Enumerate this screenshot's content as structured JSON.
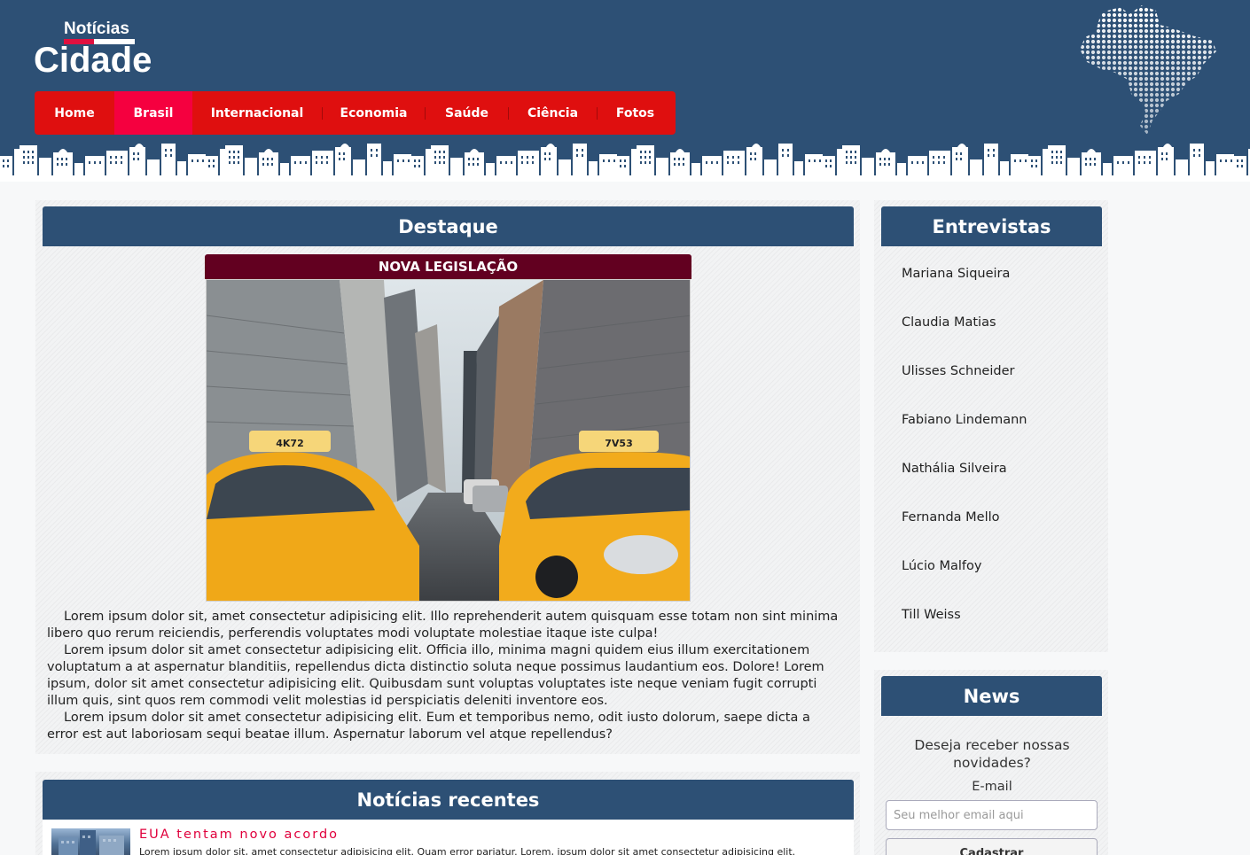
{
  "site": {
    "logo_top": "Notícias",
    "logo_main": "Cidade"
  },
  "nav": {
    "items": [
      {
        "label": "Home"
      },
      {
        "label": "Brasil"
      },
      {
        "label": "Internacional"
      },
      {
        "label": "Economia"
      },
      {
        "label": "Saúde"
      },
      {
        "label": "Ciência"
      },
      {
        "label": "Fotos"
      }
    ],
    "active": "Brasil"
  },
  "destaque": {
    "heading": "Destaque",
    "feature_title": "NOVA LEGISLAÇÃO",
    "image_alt": "táxis amarelos em rua entre prédios",
    "taxi_left": "4K72",
    "taxi_right": "7V53",
    "paragraphs": [
      "Lorem ipsum dolor sit, amet consectetur adipisicing elit. Illo reprehenderit autem quisquam esse totam non sint minima libero quo rerum reiciendis, perferendis voluptates modi voluptate molestiae itaque iste culpa!",
      "Lorem ipsum dolor sit amet consectetur adipisicing elit. Officia illo, minima magni quidem eius illum exercitationem voluptatum a at aspernatur blanditiis, repellendus dicta distinctio soluta neque possimus laudantium eos. Dolore! Lorem ipsum, dolor sit amet consectetur adipisicing elit. Quibusdam sunt voluptas voluptates iste neque veniam fugit corrupti illum quis, sint quos rem commodi velit molestias id perspiciatis deleniti inventore eos.",
      "Lorem ipsum dolor sit amet consectetur adipisicing elit. Eum et temporibus nemo, odit iusto dolorum, saepe dicta a error est aut laboriosam sequi beatae illum. Aspernatur laborum vel atque repellendus?"
    ]
  },
  "entrevistas": {
    "heading": "Entrevistas",
    "items": [
      "Mariana Siqueira",
      "Claudia Matias",
      "Ulisses Schneider",
      "Fabiano Lindemann",
      "Nathália Silveira",
      "Fernanda Mello",
      "Lúcio Malfoy",
      "Till Weiss"
    ]
  },
  "news": {
    "heading": "News",
    "question": "Deseja receber nossas novidades?",
    "email_label": "E-mail",
    "email_value": "",
    "email_placeholder": "Seu melhor email aqui",
    "submit_label": "Cadastrar"
  },
  "recentes": {
    "heading": "Notícias recentes",
    "items": [
      {
        "title": "EUA tentam novo acordo",
        "excerpt": "Lorem ipsum dolor sit, amet consectetur adipisicing elit. Quam error pariatur. Lorem, ipsum dolor sit amet consectetur adipisicing elit."
      }
    ]
  },
  "colors": {
    "header_bg": "#2d5075",
    "nav_bg": "#df0f0f",
    "nav_active": "#f5003f",
    "feature_title_bg": "#620020",
    "accent_link": "#e0003c"
  }
}
